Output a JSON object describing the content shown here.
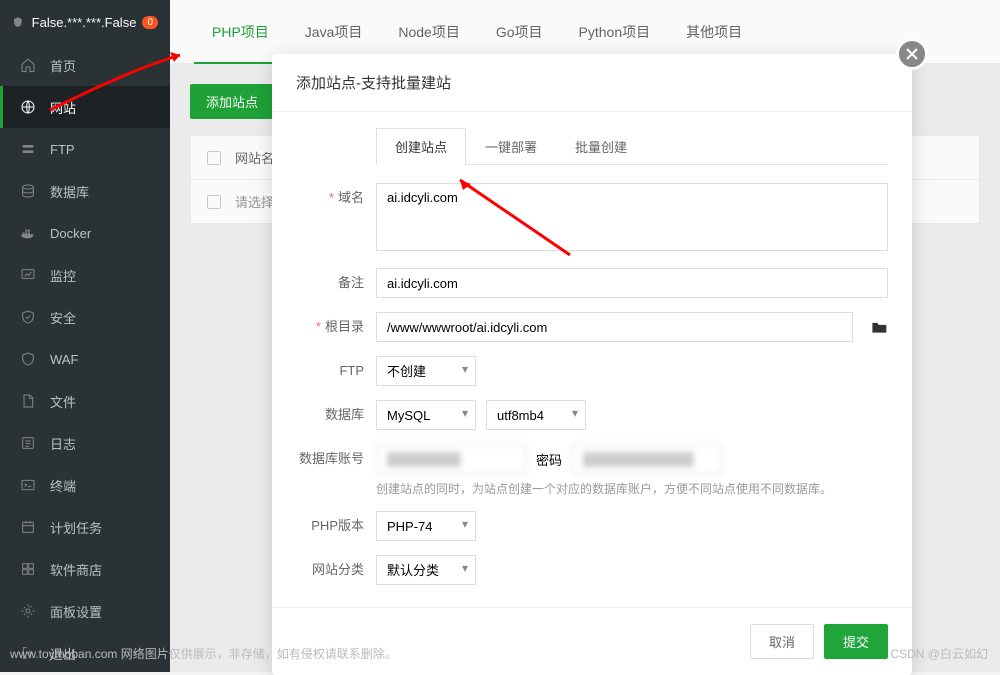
{
  "header": {
    "title": "False.***.***.False",
    "badge": "0"
  },
  "sidebar": {
    "items": [
      {
        "label": "首页"
      },
      {
        "label": "网站"
      },
      {
        "label": "FTP"
      },
      {
        "label": "数据库"
      },
      {
        "label": "Docker"
      },
      {
        "label": "监控"
      },
      {
        "label": "安全"
      },
      {
        "label": "WAF"
      },
      {
        "label": "文件"
      },
      {
        "label": "日志"
      },
      {
        "label": "终端"
      },
      {
        "label": "计划任务"
      },
      {
        "label": "软件商店"
      },
      {
        "label": "面板设置"
      },
      {
        "label": "退出"
      }
    ]
  },
  "tabs": [
    {
      "label": "PHP项目"
    },
    {
      "label": "Java项目"
    },
    {
      "label": "Node项目"
    },
    {
      "label": "Go项目"
    },
    {
      "label": "Python项目"
    },
    {
      "label": "其他项目"
    }
  ],
  "toolbar": {
    "add_site": "添加站点"
  },
  "table": {
    "col_name": "网站名",
    "placeholder_row": "请选择"
  },
  "modal": {
    "title": "添加站点-支持批量建站",
    "subtabs": [
      {
        "label": "创建站点"
      },
      {
        "label": "一键部署"
      },
      {
        "label": "批量创建"
      }
    ],
    "form": {
      "domain_label": "域名",
      "domain_value": "ai.idcyli.com",
      "remark_label": "备注",
      "remark_value": "ai.idcyli.com",
      "root_label": "根目录",
      "root_value": "/www/wwwroot/ai.idcyli.com",
      "ftp_label": "FTP",
      "ftp_value": "不创建",
      "db_label": "数据库",
      "db_engine": "MySQL",
      "db_charset": "utf8mb4",
      "db_account_label": "数据库账号",
      "db_account_value": "████████",
      "db_pwd_label": "密码",
      "db_pwd_value": "████████████",
      "db_helper": "创建站点的同时，为站点创建一个对应的数据库账户，方便不同站点使用不同数据库。",
      "php_label": "PHP版本",
      "php_value": "PHP-74",
      "category_label": "网站分类",
      "category_value": "默认分类"
    },
    "cancel": "取消",
    "submit": "提交"
  },
  "watermark": {
    "left": "www.toymoban.com 网络图片仅供展示，非存储，如有侵权请联系删除。",
    "right": "CSDN @白云如幻"
  }
}
